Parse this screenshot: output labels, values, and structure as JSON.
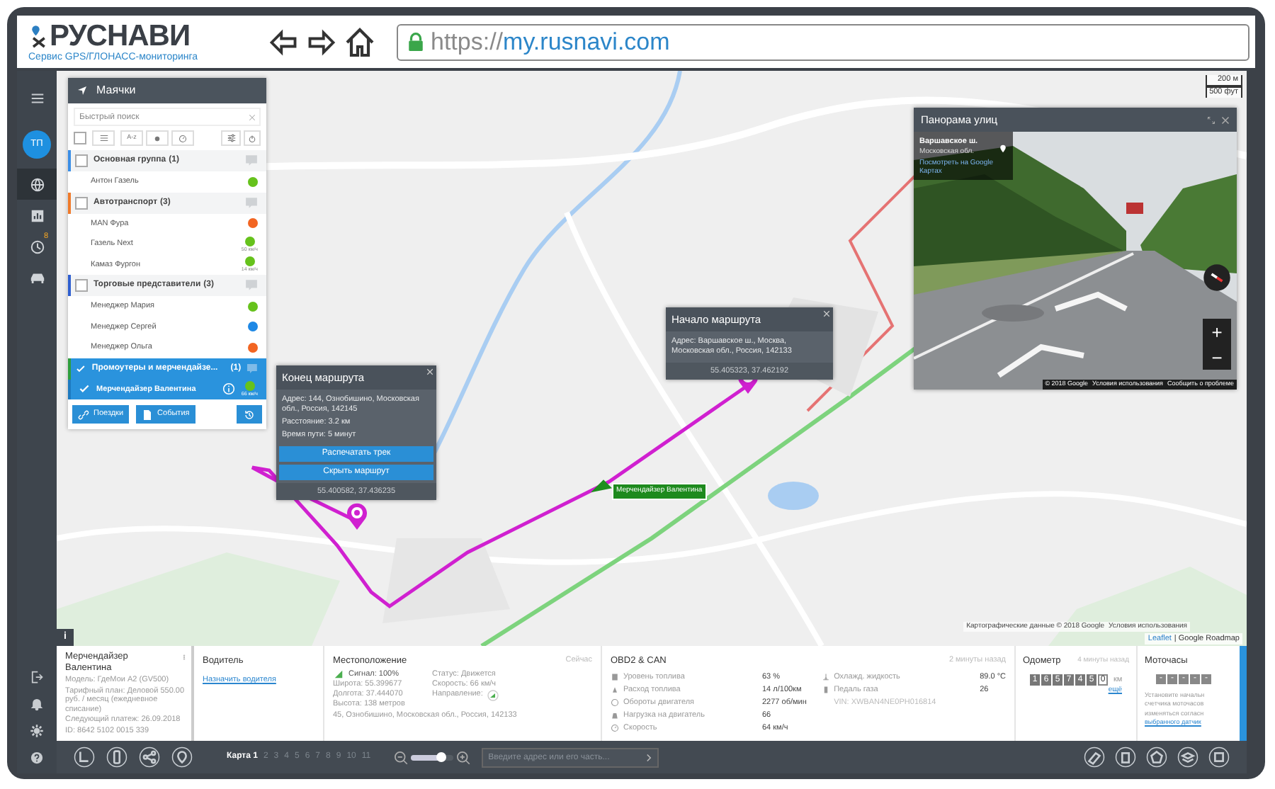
{
  "browser": {
    "logo": "РУСНАВИ",
    "tagline": "Сервис GPS/ГЛОНАСС-мониторинга",
    "url_scheme": "https://",
    "url_host": "my.rusnavi.com"
  },
  "sidebar": {
    "avatar": "ТП",
    "items": [
      {
        "kind": "globe",
        "selected": true
      },
      {
        "kind": "chart",
        "selected": false
      },
      {
        "kind": "clock",
        "selected": false,
        "badge": "8"
      },
      {
        "kind": "car",
        "selected": false
      }
    ],
    "bottom": [
      {
        "kind": "logout"
      },
      {
        "kind": "bell"
      },
      {
        "kind": "gear"
      },
      {
        "kind": "help"
      }
    ]
  },
  "trackers": {
    "title": "Маячки",
    "search": {
      "placeholder": "Быстрый поиск"
    },
    "sort_label": "A-z",
    "select_all": {
      "checked": false
    },
    "groups": [
      {
        "name": "Основная группа",
        "count": "(1)",
        "color": "#3a8ee6",
        "selected": false,
        "items": [
          {
            "name": "Антон Газель",
            "color": "#66c21c",
            "selected": false
          }
        ]
      },
      {
        "name": "Автотранспорт",
        "count": "(3)",
        "color": "#f07a2a",
        "selected": false,
        "items": [
          {
            "name": "MAN Фура",
            "color": "#f26522",
            "selected": false
          },
          {
            "name": "Газель Next",
            "color": "#66c21c",
            "speed": "50 км/ч",
            "selected": false
          },
          {
            "name": "Камаз Фургон",
            "color": "#66c21c",
            "speed": "14 км/ч",
            "selected": false
          }
        ]
      },
      {
        "name": "Торговые представители",
        "count": "(3)",
        "color": "#2f5fd0",
        "selected": false,
        "items": [
          {
            "name": "Менеджер Мария",
            "color": "#66c21c",
            "selected": false
          },
          {
            "name": "Менеджер Сергей",
            "color": "#1e88e5",
            "selected": false
          },
          {
            "name": "Менеджер Ольга",
            "color": "#f26522",
            "selected": false
          }
        ]
      },
      {
        "name": "Промоутеры и мерчендайзе...",
        "count": "(1)",
        "color": "#2e9e3e",
        "selected": true,
        "items": [
          {
            "name": "Мерчендайзер Валентина",
            "color": "#66c21c",
            "speed": "66 км/ч",
            "selected": true
          }
        ]
      }
    ],
    "buttons": [
      "Поездки",
      "События"
    ]
  },
  "map": {
    "scale": [
      "200 м",
      "500 фут"
    ],
    "route_label": "Мерчендайзер Валентина",
    "attribution": [
      "Leaflet",
      "| Google Roadmap"
    ],
    "info_button": "i",
    "map_data": "Картографические данные © 2018 Google",
    "terms": "Условия использования",
    "end_popup": {
      "title": "Конец маршрута",
      "lines": [
        "Адрес: 144, Ознобишино, Московская обл., Россия, 142145",
        "Расстояние: 3.2 км",
        "Время пути: 5 минут"
      ],
      "buttons": [
        "Распечатать трек",
        "Скрыть маршрут"
      ],
      "coords": "55.400582, 37.436235"
    },
    "start_popup": {
      "title": "Начало маршрута",
      "lines": [
        "Адрес: Варшавское ш., Москва, Московская обл., Россия, 142133"
      ],
      "coords": "55.405323, 37.462192"
    },
    "street_view": {
      "title": "Панорама улиц",
      "place": "Варшавское ш.",
      "region": "Московская обл.",
      "link": "Посмотреть на Google Картах",
      "footer": [
        "© 2018 Google",
        "Условия использования",
        "Сообщить о проблеме"
      ],
      "zoom": [
        "+",
        "−"
      ]
    }
  },
  "device": {
    "name": "Мерчендайзер Валентина",
    "lines": [
      "Модель: ГдеМои A2 (GV500)",
      "Тарифный план: Деловой 550.00 руб. / месяц (ежедневное списание)",
      "Следующий платеж: 26.09.2018",
      "ID: 8642 5102 0015 339"
    ]
  },
  "driver": {
    "title": "Водитель",
    "link": "Назначить водителя"
  },
  "location": {
    "title": "Местоположение",
    "time": "Сейчас",
    "signal": "Сигнал: 100%",
    "left": [
      "Широта: 55.399677",
      "Долгота: 37.444070",
      "Высота: 138 метров"
    ],
    "right": [
      "Статус: Движется",
      "Скорость: 66 км/ч"
    ],
    "direction": "Направление:",
    "address": "45, Ознобишино, Московская обл., Россия, 142133"
  },
  "obd": {
    "title": "OBD2 & CAN",
    "time": "2 минуты назад",
    "rows": [
      {
        "label": "Уровень топлива",
        "value": "63 %"
      },
      {
        "label": "Расход топлива",
        "value": "14 л/100км"
      },
      {
        "label": "Обороты двигателя",
        "value": "2277 об/мин"
      },
      {
        "label": "Нагрузка на двигатель",
        "value": "66"
      },
      {
        "label": "Скорость",
        "value": "64 км/ч"
      }
    ],
    "rows2": [
      {
        "label": "Охлажд. жидкость",
        "value": "89.0 °C"
      },
      {
        "label": "Педаль газа",
        "value": "26"
      }
    ],
    "vin": "VIN: XWBAN4NE0PH016814"
  },
  "odometer": {
    "title": "Одометр",
    "time": "4 минуты назад",
    "digits": [
      "1",
      "6",
      "5",
      "7",
      "4",
      "5",
      "0"
    ],
    "unit": "км",
    "link": "ещё"
  },
  "engine_hours": {
    "title": "Моточасы",
    "cells": [
      "-",
      "-",
      "-",
      "-",
      "-"
    ],
    "lines": [
      "Установите начальн",
      "счетчика моточасов",
      "изменяться согласн"
    ],
    "link": "выбранного датчик"
  },
  "toolbar": {
    "maps": [
      {
        "label": "Карта 1",
        "selected": true
      },
      {
        "label": "2",
        "selected": false
      },
      {
        "label": "3",
        "selected": false
      },
      {
        "label": "4",
        "selected": false
      },
      {
        "label": "5",
        "selected": false
      },
      {
        "label": "6",
        "selected": false
      },
      {
        "label": "7",
        "selected": false
      },
      {
        "label": "8",
        "selected": false
      },
      {
        "label": "9",
        "selected": false
      },
      {
        "label": "10",
        "selected": false
      },
      {
        "label": "11",
        "selected": false
      }
    ],
    "zoom": {
      "level": 0.72
    },
    "address": {
      "placeholder": "Введите адрес или его часть..."
    }
  }
}
